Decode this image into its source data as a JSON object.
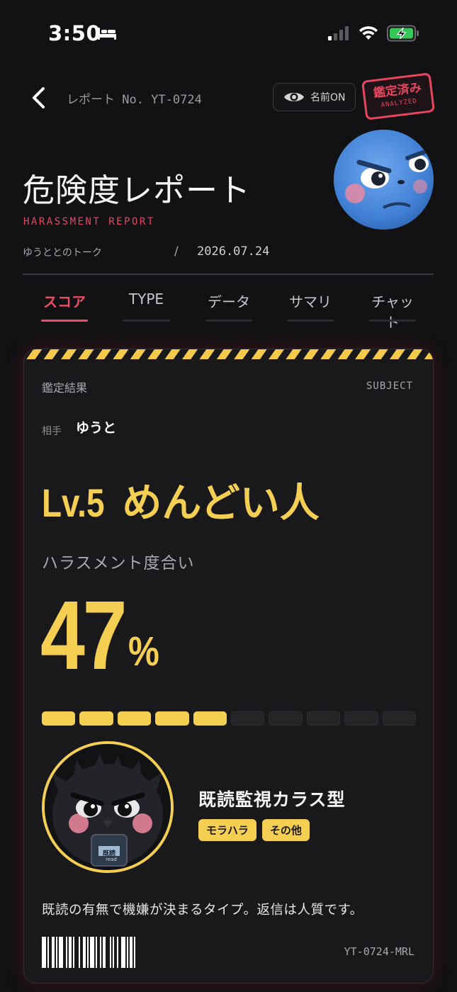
{
  "status_bar": {
    "time": "3:50",
    "icons": [
      "bed-icon",
      "signal-icon",
      "wifi-icon",
      "battery-charging-icon"
    ]
  },
  "header": {
    "back_icon": "chevron-left-icon",
    "report_no": "レポート No. YT-0724",
    "name_toggle": {
      "icon": "eye-icon",
      "label": "名前ON"
    },
    "stamp": {
      "main": "鑑定済み",
      "sub": "ANALYZED"
    },
    "title": "危険度レポート",
    "subtitle": "HARASSMENT REPORT",
    "talk": "ゆうととのトーク",
    "separator": "/",
    "date": "2026.07.24"
  },
  "tabs": [
    {
      "label": "スコア",
      "active": true
    },
    {
      "label": "TYPE",
      "active": false
    },
    {
      "label": "データ",
      "active": false
    },
    {
      "label": "サマリ",
      "active": false
    },
    {
      "label": "チャット",
      "active": false
    }
  ],
  "card": {
    "section_label": "鑑定結果",
    "subject_label": "SUBJECT",
    "opponent_label": "相手",
    "opponent_name": "ゆうと",
    "level_prefix": "Lv.5",
    "level_text": "めんどい人",
    "harassment_label": "ハラスメント度合い",
    "score": "47",
    "score_unit": "%",
    "meter": {
      "filled": 5,
      "total": 10
    },
    "type_name": "既読監視カラス型",
    "tags": [
      "モラハラ",
      "その他"
    ],
    "phone_text": "既読",
    "phone_sub": "read",
    "description": "既読の有無で機嫌が決まるタイプ。返信は人質です。",
    "code": "YT-0724-MRL"
  },
  "colors": {
    "background": "#121214",
    "card": "#19191c",
    "accent_pink": "#ec4d64",
    "accent_yellow": "#f5cf52"
  }
}
